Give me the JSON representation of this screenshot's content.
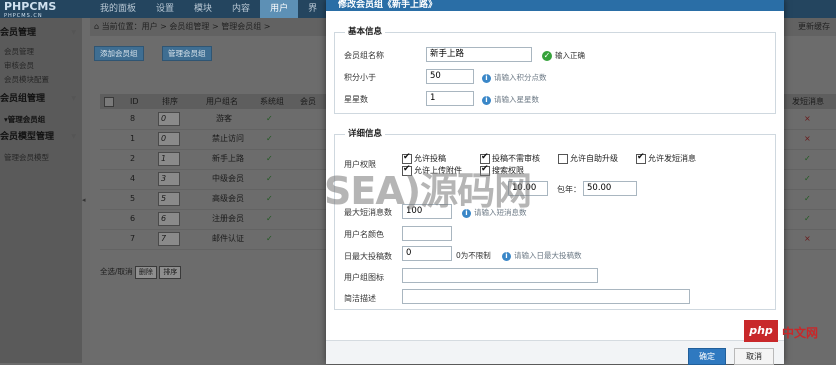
{
  "app": {
    "logo_text": "PHPCMS",
    "logo_sub": "PHPCMS.CN",
    "nav": [
      "我的面板",
      "设置",
      "模块",
      "内容",
      "用户",
      "界"
    ],
    "active_nav": "用户"
  },
  "sidebar": {
    "sections": [
      {
        "title": "会员管理",
        "items": [
          "会员管理",
          "审核会员",
          "会员模块配置"
        ]
      },
      {
        "title": "会员组管理",
        "items": [
          "管理会员组"
        ]
      },
      {
        "title": "会员模型管理",
        "items": [
          "管理会员模型"
        ]
      }
    ]
  },
  "breadcrumb": {
    "text": "当前位置：用户 > 会员组管理 > 管理会员组 >",
    "right_link": "更新缓存"
  },
  "toolbar": {
    "add_label": "添加会员组",
    "manage_label": "管理会员组"
  },
  "table": {
    "headers": [
      "ID",
      "排序",
      "用户组名",
      "系统组",
      "会员",
      "发短消息"
    ],
    "rows": [
      {
        "id": "8",
        "order": "0",
        "name": "游客",
        "system": "✓",
        "msg": "×"
      },
      {
        "id": "1",
        "order": "0",
        "name": "禁止访问",
        "system": "✓",
        "msg": "×"
      },
      {
        "id": "2",
        "order": "1",
        "name": "新手上路",
        "system": "✓",
        "msg": "✓"
      },
      {
        "id": "4",
        "order": "3",
        "name": "中级会员",
        "system": "✓",
        "msg": "✓"
      },
      {
        "id": "5",
        "order": "5",
        "name": "高级会员",
        "system": "✓",
        "msg": "✓"
      },
      {
        "id": "6",
        "order": "6",
        "name": "注册会员",
        "system": "✓",
        "msg": "✓"
      },
      {
        "id": "7",
        "order": "7",
        "name": "邮件认证",
        "system": "✓",
        "msg": "×"
      }
    ],
    "bulk_label": "全选/取消",
    "bulk_delete": "删除",
    "bulk_sort": "排序"
  },
  "modal": {
    "title": "修改会员组《新手上路》",
    "basic_legend": "基本信息",
    "detail_legend": "详细信息",
    "fields": {
      "name_label": "会员组名称",
      "name_value": "新手上路",
      "name_ok": "输入正确",
      "points_label": "积分小于",
      "points_value": "50",
      "points_hint": "请输入积分点数",
      "stars_label": "星星数",
      "stars_value": "1",
      "stars_hint": "请输入星星数",
      "perm_label": "用户权限",
      "perms": [
        {
          "label": "允许投稿",
          "checked": true
        },
        {
          "label": "投稿不需审核",
          "checked": true
        },
        {
          "label": "允许自助升级",
          "checked": false
        },
        {
          "label": "允许发短消息",
          "checked": true
        },
        {
          "label": "允许上传附件",
          "checked": true
        },
        {
          "label": "搜索权限",
          "checked": true
        }
      ],
      "price_value_1": "10.00",
      "year_label": "包年：",
      "year_value": "50.00",
      "maxmsg_label": "最大短消息数",
      "maxmsg_value": "100",
      "maxmsg_hint": "请输入短消息数",
      "color_label": "用户名颜色",
      "color_value": "",
      "daily_label": "日最大投稿数",
      "daily_value": "0",
      "daily_note": "0为不限制",
      "daily_hint": "请输入日最大投稿数",
      "icon_label": "用户组图标",
      "icon_value": "",
      "desc_label": "简洁描述",
      "desc_value": ""
    },
    "confirm_label": "确定",
    "cancel_label": "取消"
  },
  "watermark": "SEA)源码网",
  "badge": {
    "logo": "php",
    "text": "中文网"
  }
}
